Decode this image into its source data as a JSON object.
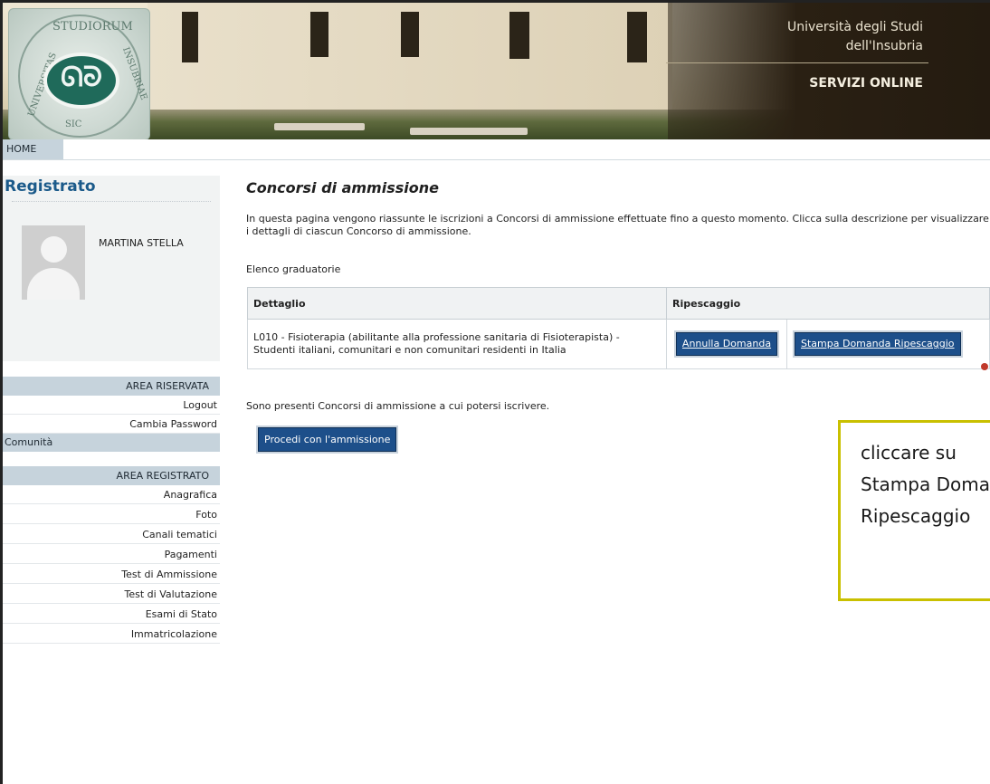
{
  "header": {
    "university_line1": "Università degli Studi",
    "university_line2": "dell'Insubria",
    "servizi": "SERVIZI ONLINE",
    "seal_text_1": "STUDIORUM",
    "seal_text_2": "INSUBRIAE",
    "seal_text_3": "UNIVERSITAS",
    "seal_text_4": "SIC"
  },
  "nav": {
    "home": "HOME"
  },
  "sidebar": {
    "title": "Registrato",
    "user_name": "MARTINA STELLA",
    "area_riservata": "AREA RISERVATA",
    "logout": "Logout",
    "cambia_password": "Cambia Password",
    "comunita": "Comunità",
    "area_registrato": "AREA REGISTRATO",
    "menu": [
      "Anagrafica",
      "Foto",
      "Canali tematici",
      "Pagamenti",
      "Test di Ammissione",
      "Test di Valutazione",
      "Esami di Stato",
      "Immatricolazione"
    ]
  },
  "main": {
    "title": "Concorsi di ammissione",
    "intro": "In questa pagina vengono riassunte le iscrizioni a Concorsi di ammissione effettuate fino a questo momento. Clicca sulla descrizione per visualizzare i dettagli di ciascun Concorso di ammissione.",
    "list_title": "Elenco graduatorie",
    "table": {
      "headers": [
        "Dettaglio",
        "Ripescaggio"
      ],
      "rows": [
        {
          "dettaglio": "L010 - Fisioterapia (abilitante alla professione sanitaria di Fisioterapista) - Studenti italiani, comunitari e non comunitari residenti in Italia",
          "annulla": "Annulla Domanda",
          "stampa": "Stampa Domanda Ripescaggio"
        }
      ]
    },
    "available_text": "Sono presenti Concorsi di ammissione a cui potersi iscrivere.",
    "proceed_button": "Procedi con l'ammissione"
  },
  "callout": {
    "text": "cliccare su\nStampa Domanda\nRipescaggio"
  },
  "colors": {
    "brand_blue": "#1d4f8a",
    "section_bg": "#c6d3dc",
    "callout_border": "#c9c000",
    "title_blue": "#1b5a8a"
  }
}
